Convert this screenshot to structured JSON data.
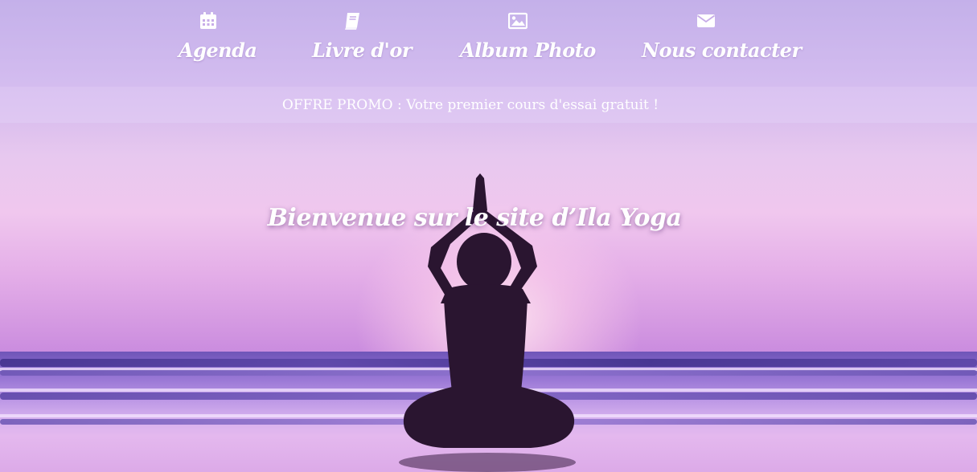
{
  "nav": {
    "items": [
      {
        "label": "Agenda",
        "icon": "calendar-icon"
      },
      {
        "label": "Livre d'or",
        "icon": "book-icon"
      },
      {
        "label": "Album Photo",
        "icon": "image-icon"
      },
      {
        "label": "Nous contacter",
        "icon": "envelope-icon"
      }
    ]
  },
  "promo": {
    "text": "OFFRE PROMO : Votre premier cours d'essai gratuit !"
  },
  "hero": {
    "title": "Bienvenue sur le site d’Ila Yoga"
  },
  "colors": {
    "text": "#ffffff",
    "sky_top": "#b7a4e3",
    "sky_mid": "#f0c7ee",
    "sea": "#6f55b8",
    "silhouette": "#2a1530"
  }
}
